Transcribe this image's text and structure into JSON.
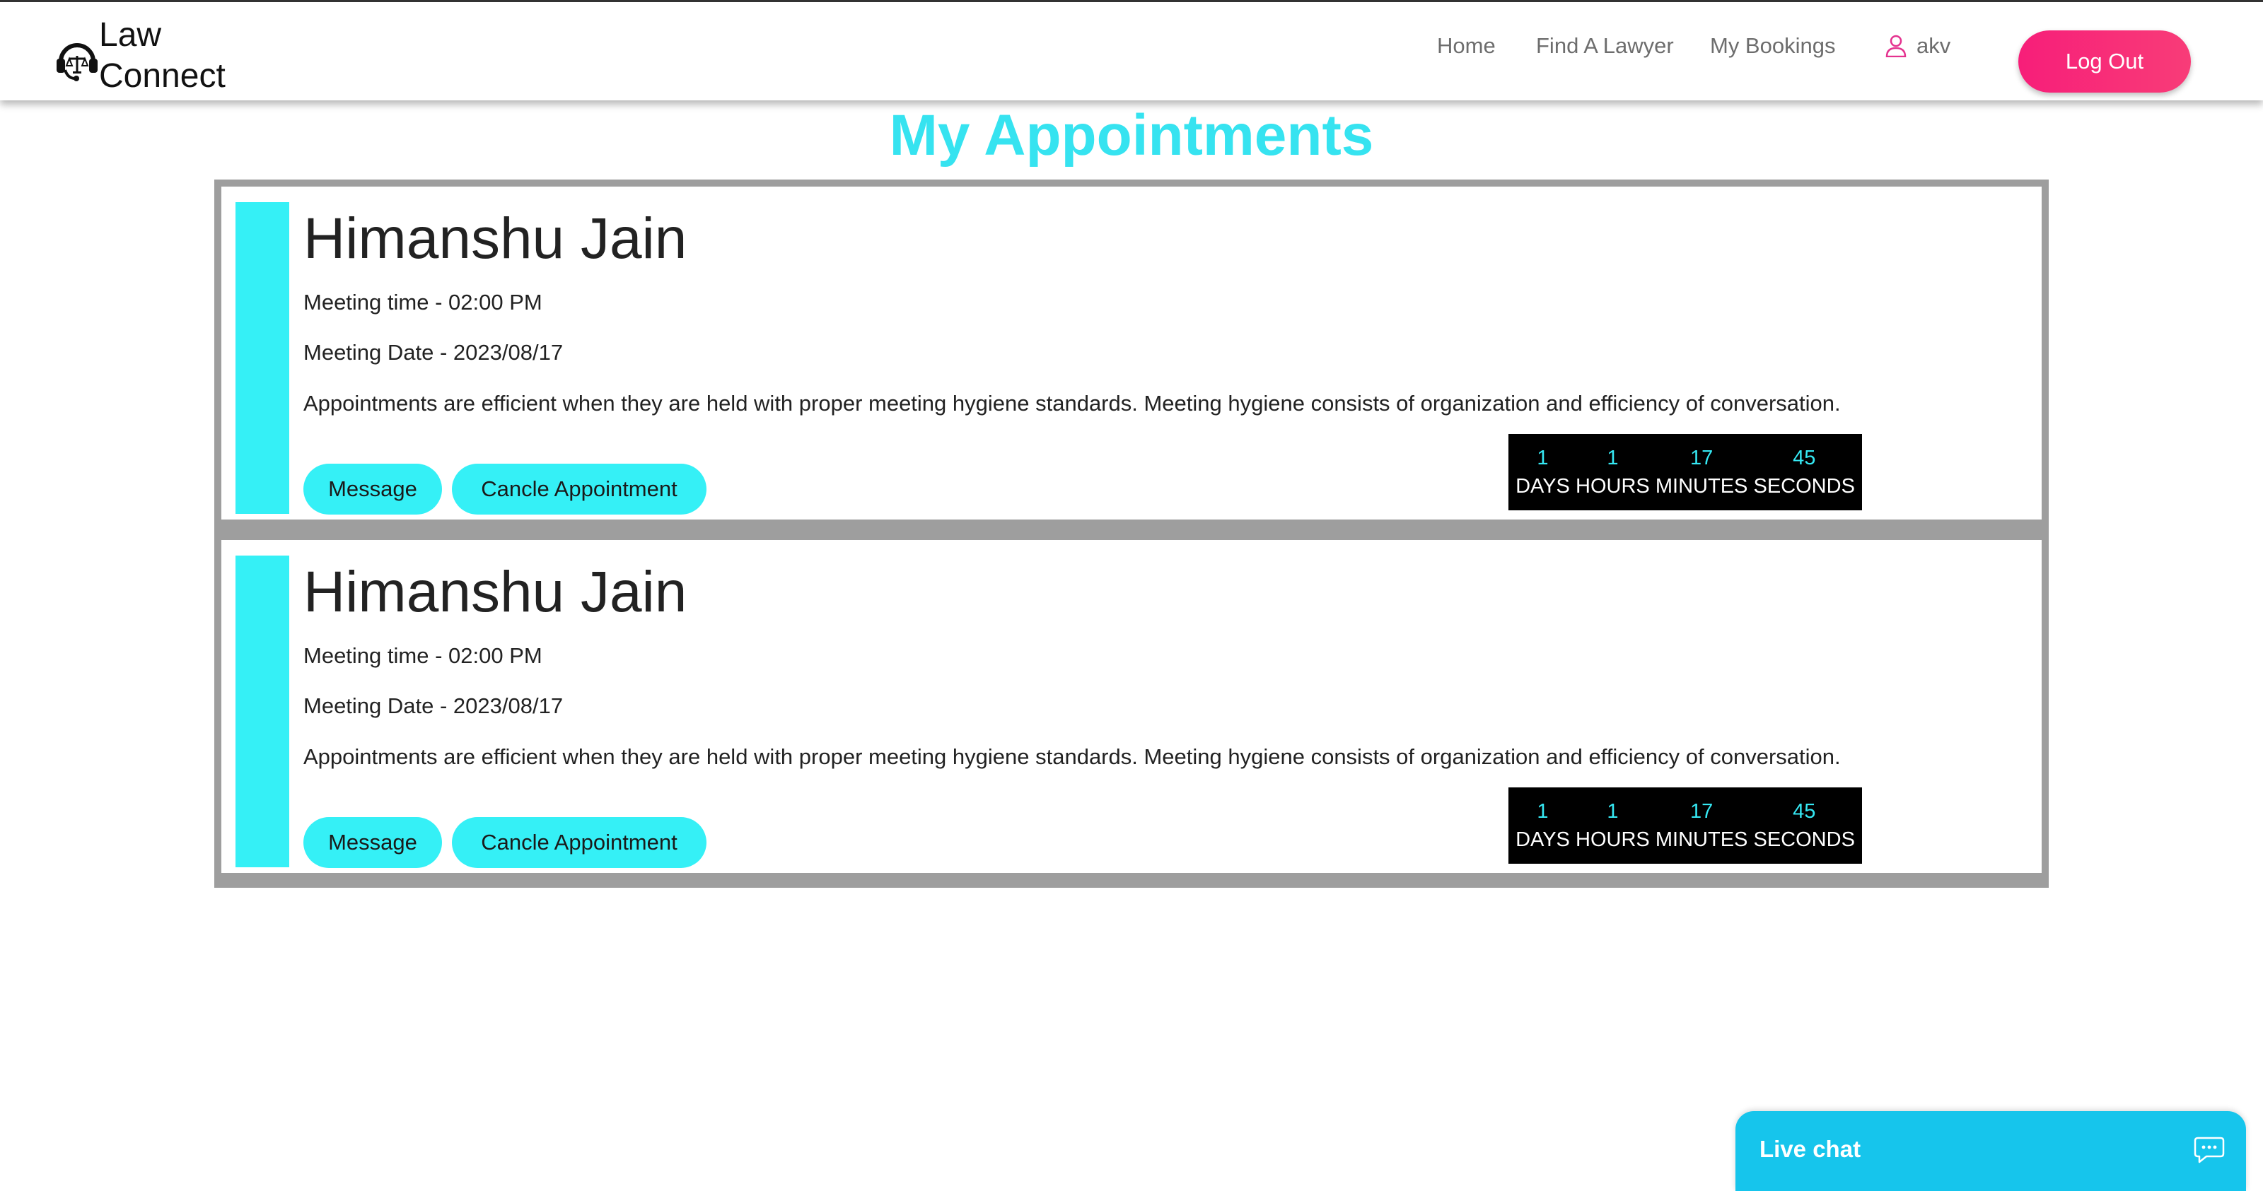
{
  "navbar": {
    "brand_text": "Law\nConnect",
    "links": [
      "Home",
      "Find A Lawyer",
      "My Bookings"
    ],
    "user_name": "akv",
    "logout_label": "Log Out"
  },
  "page": {
    "title": "My Appointments"
  },
  "appointments": [
    {
      "name": "Himanshu Jain",
      "meeting_time": "Meeting time - 02:00 PM",
      "meeting_date": "Meeting Date - 2023/08/17",
      "description": "Appointments are efficient when they are held with proper meeting hygiene standards. Meeting hygiene consists of organization and efficiency of conversation.",
      "message_label": "Message",
      "cancel_label": "Cancle Appointment",
      "countdown": [
        {
          "value": "1",
          "label": "DAYS"
        },
        {
          "value": "1",
          "label": "HOURS"
        },
        {
          "value": "17",
          "label": "MINUTES"
        },
        {
          "value": "45",
          "label": "SECONDS"
        }
      ]
    },
    {
      "name": "Himanshu Jain",
      "meeting_time": "Meeting time - 02:00 PM",
      "meeting_date": "Meeting Date - 2023/08/17",
      "description": "Appointments are efficient when they are held with proper meeting hygiene standards. Meeting hygiene consists of organization and efficiency of conversation.",
      "message_label": "Message",
      "cancel_label": "Cancle Appointment",
      "countdown": [
        {
          "value": "1",
          "label": "DAYS"
        },
        {
          "value": "1",
          "label": "HOURS"
        },
        {
          "value": "17",
          "label": "MINUTES"
        },
        {
          "value": "45",
          "label": "SECONDS"
        }
      ]
    }
  ],
  "live_chat": {
    "label": "Live chat"
  },
  "colors": {
    "accent_cyan": "#35f0f6",
    "title_cyan": "#36e3f0",
    "logout_pink": "#f71e79",
    "live_chat_blue": "#16c5ec",
    "countdown_bg": "#000000"
  },
  "icons": {
    "brand": "lawyer-headset-scales-icon",
    "user": "user-icon",
    "chat": "chat-bubble-icon"
  }
}
